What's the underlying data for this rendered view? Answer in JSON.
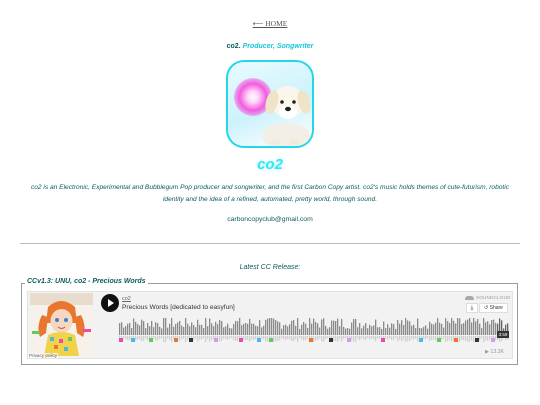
{
  "nav": {
    "home_label": "⟵ HOME"
  },
  "header": {
    "artist_prefix": "co2.",
    "role": "Producer, Songwriter"
  },
  "artist": {
    "name": "co2",
    "bio": "co2 is an Electronic, Experimental and Bubblegum Pop producer and songwriter, and the first Carbon Copy artist. co2's music holds themes of cute-futurism, robotic identity and the idea of a refined, automated, pretty world, through sound.",
    "email": "carboncopyclub@gmail.com"
  },
  "release": {
    "section_label": "Latest CC Release:",
    "title": "CCv1.3: UNU, co2 - Precious Words"
  },
  "player": {
    "artist": "co2",
    "track_title": "Precious Words [dedicated to easyfun]",
    "brand": "SOUNDCLOUD",
    "download_icon": "download-icon",
    "share_label": "Share",
    "duration": "3:59",
    "play_count": "▶ 13.3K",
    "privacy_label": "Privacy policy"
  },
  "colors": {
    "accent": "#33e6f4",
    "text": "#0b5c5c",
    "avatar_border": "#24d6e8"
  }
}
